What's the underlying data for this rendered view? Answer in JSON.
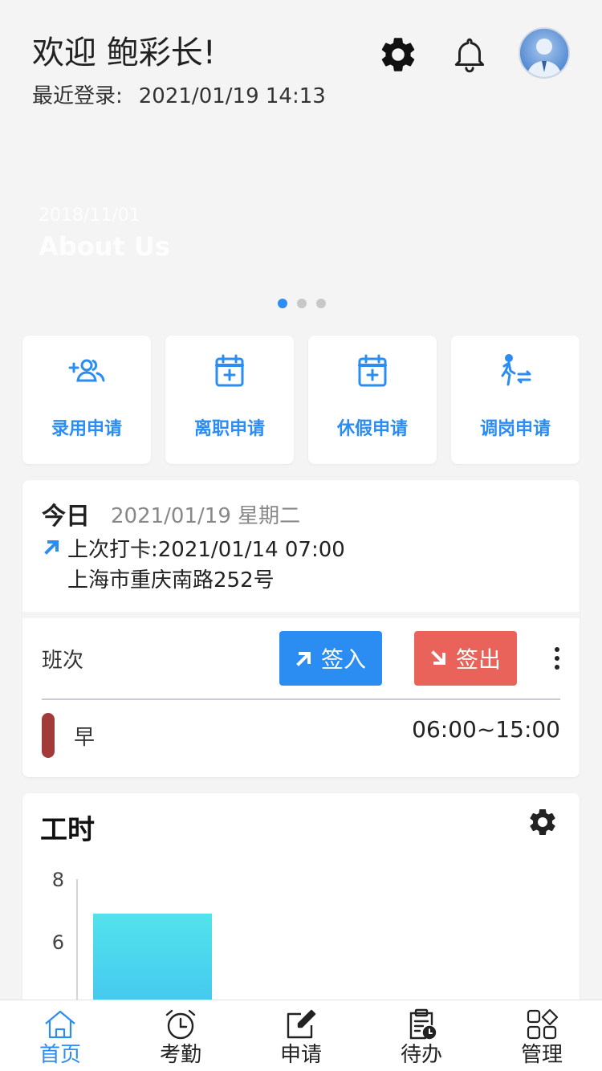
{
  "header": {
    "welcome": "欢迎 鲍彩长!",
    "last_login_label": "最近登录:",
    "last_login_time": "2021/01/19 14:13",
    "settings_icon": "gear-icon",
    "bell_icon": "bell-icon",
    "avatar_icon": "user-avatar"
  },
  "banner": {
    "date": "2018/11/01",
    "title": "About Us",
    "active_slide": 1,
    "slide_count": 3
  },
  "quick_actions": [
    {
      "label": "录用申请",
      "icon": "add-user-icon"
    },
    {
      "label": "离职申请",
      "icon": "calendar-plus-icon"
    },
    {
      "label": "休假申请",
      "icon": "calendar-plus-icon"
    },
    {
      "label": "调岗申请",
      "icon": "walk-transfer-icon"
    }
  ],
  "attendance": {
    "today_label": "今日",
    "today_date": "2021/01/19 星期二",
    "last_punch": "上次打卡:2021/01/14 07:00",
    "address": "上海市重庆南路252号",
    "shift_label": "班次",
    "check_in": "签入",
    "check_out": "签出",
    "shift_name": "早",
    "shift_time": "06:00~15:00"
  },
  "work_hours": {
    "title": "工时",
    "chart_data": {
      "type": "bar",
      "categories": [
        ""
      ],
      "values": [
        6.9
      ],
      "ylabel": "",
      "xlabel": "",
      "yticks": [
        6,
        8
      ],
      "ylim": [
        0,
        8
      ]
    }
  },
  "tabbar": [
    {
      "label": "首页",
      "icon": "home-icon",
      "active": true
    },
    {
      "label": "考勤",
      "icon": "alarm-clock-icon",
      "active": false
    },
    {
      "label": "申请",
      "icon": "edit-icon",
      "active": false
    },
    {
      "label": "待办",
      "icon": "clipboard-clock-icon",
      "active": false
    },
    {
      "label": "管理",
      "icon": "grid-icon",
      "active": false
    }
  ],
  "colors": {
    "accent": "#2b8cf2",
    "danger": "#e9635a",
    "shift_bar": "#a33a3a",
    "bar_top": "#52e3ec",
    "bar_bottom": "#40c0f0"
  }
}
